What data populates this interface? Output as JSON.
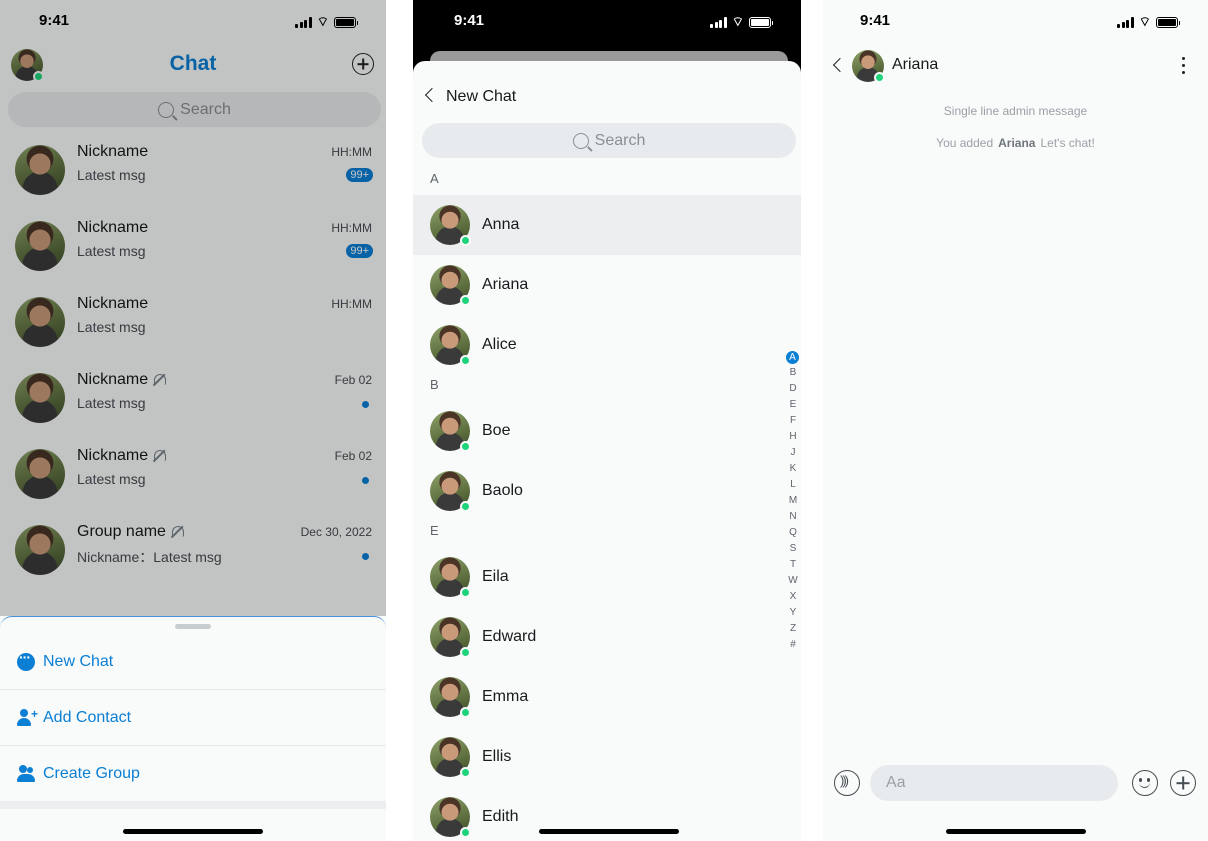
{
  "status_time": "9:41",
  "colors": {
    "accent": "#0a7fd4",
    "online": "#1ed47a"
  },
  "screen1": {
    "title": "Chat",
    "search_placeholder": "Search",
    "conversations": [
      {
        "name": "Nickname",
        "msg": "Latest msg",
        "time": "HH:MM",
        "badge": "99+"
      },
      {
        "name": "Nickname",
        "msg": "Latest msg",
        "time": "HH:MM",
        "badge": "99+"
      },
      {
        "name": "Nickname",
        "msg": "Latest msg",
        "time": "HH:MM"
      },
      {
        "name": "Nickname",
        "msg": "Latest msg",
        "time": "Feb 02",
        "muted": true,
        "dot": true
      },
      {
        "name": "Nickname",
        "msg": "Latest msg",
        "time": "Feb 02",
        "muted": true,
        "dot": true
      },
      {
        "name": "Group name",
        "msg": "Nickname：Latest msg",
        "time": "Dec 30, 2022",
        "muted": true,
        "dot": true
      }
    ],
    "sheet": {
      "new_chat": "New Chat",
      "add_contact": "Add Contact",
      "create_group": "Create Group"
    }
  },
  "screen2": {
    "title": "New Chat",
    "search_placeholder": "Search",
    "sections": [
      {
        "letter": "A",
        "contacts": [
          "Anna",
          "Ariana",
          "Alice"
        ]
      },
      {
        "letter": "B",
        "contacts": [
          "Boe",
          "Baolo"
        ]
      },
      {
        "letter": "E",
        "contacts": [
          "Eila",
          "Edward",
          "Emma",
          "Ellis",
          "Edith"
        ]
      }
    ],
    "index": [
      "A",
      "B",
      "D",
      "E",
      "F",
      "H",
      "J",
      "K",
      "L",
      "M",
      "N",
      "Q",
      "S",
      "T",
      "W",
      "X",
      "Y",
      "Z",
      "#"
    ],
    "index_active": "A"
  },
  "screen3": {
    "contact_name": "Ariana",
    "admin_message": "Single line admin message",
    "added_prefix": "You added",
    "added_name": "Ariana",
    "added_suffix": "Let's chat!",
    "input_placeholder": "Aa"
  }
}
